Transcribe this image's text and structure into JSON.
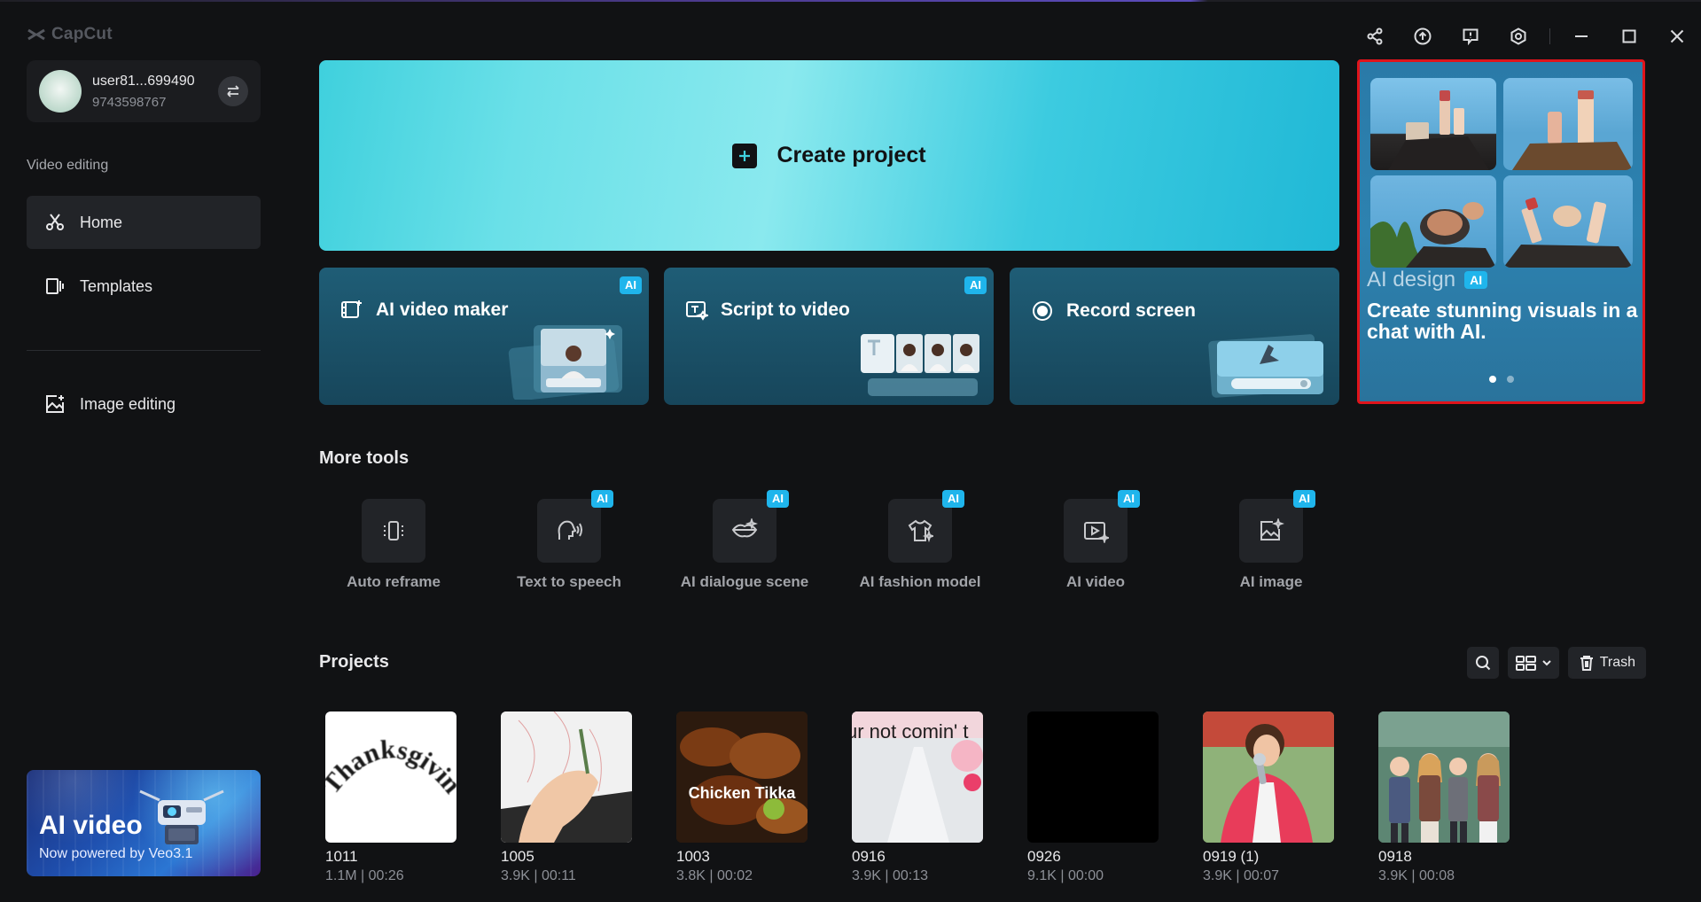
{
  "app": {
    "name": "CapCut"
  },
  "account": {
    "name": "user81...699490",
    "phone": "9743598767"
  },
  "sidebar": {
    "section_label": "Video editing",
    "items": [
      {
        "label": "Home",
        "active": true
      },
      {
        "label": "Templates",
        "active": false
      },
      {
        "label": "Image editing",
        "active": false
      }
    ],
    "promo": {
      "title": "AI video",
      "subtitle": "Now powered by Veo3.1"
    }
  },
  "main": {
    "create_project": "Create project",
    "feature_cards": [
      {
        "label": "AI video maker",
        "badge": "AI"
      },
      {
        "label": "Script to video",
        "badge": "AI"
      },
      {
        "label": "Record screen",
        "badge": ""
      }
    ],
    "banner": {
      "title": "AI design",
      "badge": "AI",
      "text": "Create stunning visuals in a chat with AI.",
      "active_slide": 1,
      "slide_count": 2
    },
    "more_tools_title": "More tools",
    "tools": [
      {
        "label": "Auto reframe",
        "badge": ""
      },
      {
        "label": "Text to speech",
        "badge": "AI"
      },
      {
        "label": "AI dialogue scene",
        "badge": "AI"
      },
      {
        "label": "AI fashion model",
        "badge": "AI"
      },
      {
        "label": "AI video",
        "badge": "AI"
      },
      {
        "label": "AI image",
        "badge": "AI"
      }
    ],
    "projects_title": "Projects",
    "trash_label": "Trash",
    "projects": [
      {
        "name": "1011",
        "meta": "1.1M | 00:26",
        "thumb_text": "Thanksgiving"
      },
      {
        "name": "1005",
        "meta": "3.9K | 00:11",
        "thumb_text": ""
      },
      {
        "name": "1003",
        "meta": "3.8K | 00:02",
        "thumb_text": "Chicken Tikka"
      },
      {
        "name": "0916",
        "meta": "3.9K | 00:13",
        "thumb_text": "ur not comin' t"
      },
      {
        "name": "0926",
        "meta": "9.1K | 00:00",
        "thumb_text": ""
      },
      {
        "name": "0919 (1)",
        "meta": "3.9K | 00:07",
        "thumb_text": ""
      },
      {
        "name": "0918",
        "meta": "3.9K | 00:08",
        "thumb_text": ""
      }
    ]
  },
  "colors": {
    "background": "#111214",
    "accent": "#1fb5ec",
    "banner_border": "#e0141b"
  }
}
